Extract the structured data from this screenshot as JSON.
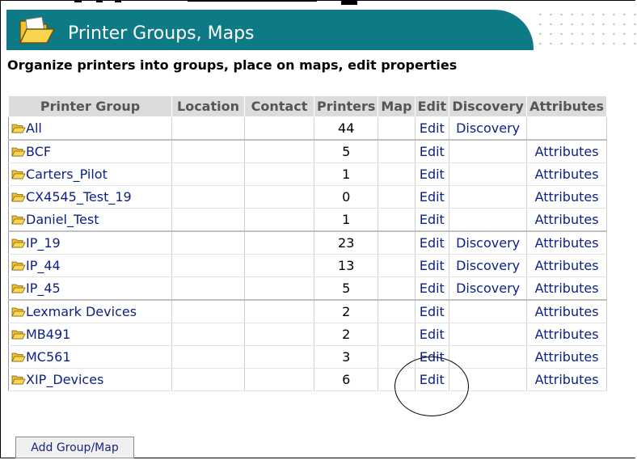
{
  "header": {
    "title": "Printer Groups, Maps",
    "subtitle": "Organize printers into groups, place on maps, edit properties",
    "icon": "open-folder-icon",
    "bar_color": "#0e7a86"
  },
  "table": {
    "columns": [
      "Printer Group",
      "Location",
      "Contact",
      "Printers",
      "Map",
      "Edit",
      "Discovery",
      "Attributes"
    ],
    "rows": [
      {
        "group": "All",
        "location": "",
        "contact": "",
        "printers": "44",
        "map": "",
        "edit": "Edit",
        "discovery": "Discovery",
        "attributes": ""
      },
      {
        "group": "BCF",
        "location": "",
        "contact": "",
        "printers": "5",
        "map": "",
        "edit": "Edit",
        "discovery": "",
        "attributes": "Attributes"
      },
      {
        "group": "Carters_Pilot",
        "location": "",
        "contact": "",
        "printers": "1",
        "map": "",
        "edit": "Edit",
        "discovery": "",
        "attributes": "Attributes"
      },
      {
        "group": "CX4545_Test_19",
        "location": "",
        "contact": "",
        "printers": "0",
        "map": "",
        "edit": "Edit",
        "discovery": "",
        "attributes": "Attributes"
      },
      {
        "group": "Daniel_Test",
        "location": "",
        "contact": "",
        "printers": "1",
        "map": "",
        "edit": "Edit",
        "discovery": "",
        "attributes": "Attributes"
      },
      {
        "group": "IP_19",
        "location": "",
        "contact": "",
        "printers": "23",
        "map": "",
        "edit": "Edit",
        "discovery": "Discovery",
        "attributes": "Attributes"
      },
      {
        "group": "IP_44",
        "location": "",
        "contact": "",
        "printers": "13",
        "map": "",
        "edit": "Edit",
        "discovery": "Discovery",
        "attributes": "Attributes"
      },
      {
        "group": "IP_45",
        "location": "",
        "contact": "",
        "printers": "5",
        "map": "",
        "edit": "Edit",
        "discovery": "Discovery",
        "attributes": "Attributes"
      },
      {
        "group": "Lexmark Devices",
        "location": "",
        "contact": "",
        "printers": "2",
        "map": "",
        "edit": "Edit",
        "discovery": "",
        "attributes": "Attributes"
      },
      {
        "group": "MB491",
        "location": "",
        "contact": "",
        "printers": "2",
        "map": "",
        "edit": "Edit",
        "discovery": "",
        "attributes": "Attributes"
      },
      {
        "group": "MC561",
        "location": "",
        "contact": "",
        "printers": "3",
        "map": "",
        "edit": "Edit",
        "discovery": "",
        "attributes": "Attributes"
      },
      {
        "group": "XIP_Devices",
        "location": "",
        "contact": "",
        "printers": "6",
        "map": "",
        "edit": "Edit",
        "discovery": "",
        "attributes": "Attributes"
      }
    ]
  },
  "add_button": {
    "label": "Add Group/Map"
  },
  "annotation": {
    "shape": "ellipse",
    "around": "Edit links of MC561 and XIP_Devices"
  }
}
